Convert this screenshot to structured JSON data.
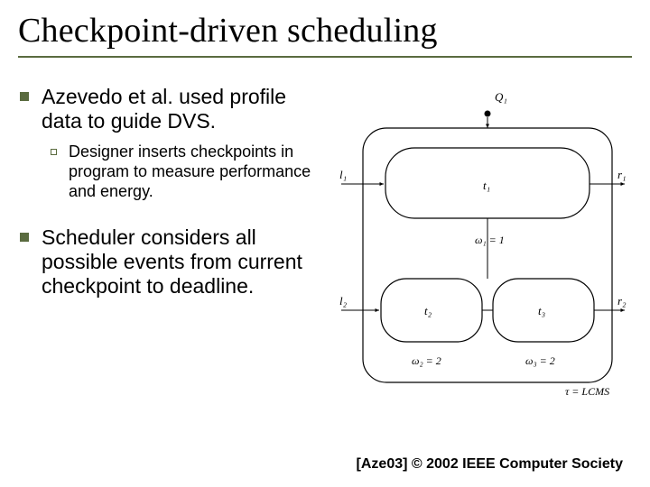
{
  "title": "Checkpoint-driven scheduling",
  "bullets": {
    "b1": "Azevedo et al. used profile data to guide DVS.",
    "b1a": "Designer inserts checkpoints in program to measure performance and energy.",
    "b2": "Scheduler considers all possible events from current checkpoint to deadline."
  },
  "citation": "[Aze03] © 2002 IEEE Computer Society",
  "diagram": {
    "labels": {
      "Q1": "Q₁",
      "l1": "l₁",
      "r1": "r₁",
      "t1": "t₁",
      "w1": "ω₁ = 1",
      "l2": "l₂",
      "r2": "r₂",
      "t2": "t₂",
      "t3": "t₃",
      "w2": "ω₂ = 2",
      "w3": "ω₃ = 2",
      "tau": "τ = LCMS"
    }
  }
}
